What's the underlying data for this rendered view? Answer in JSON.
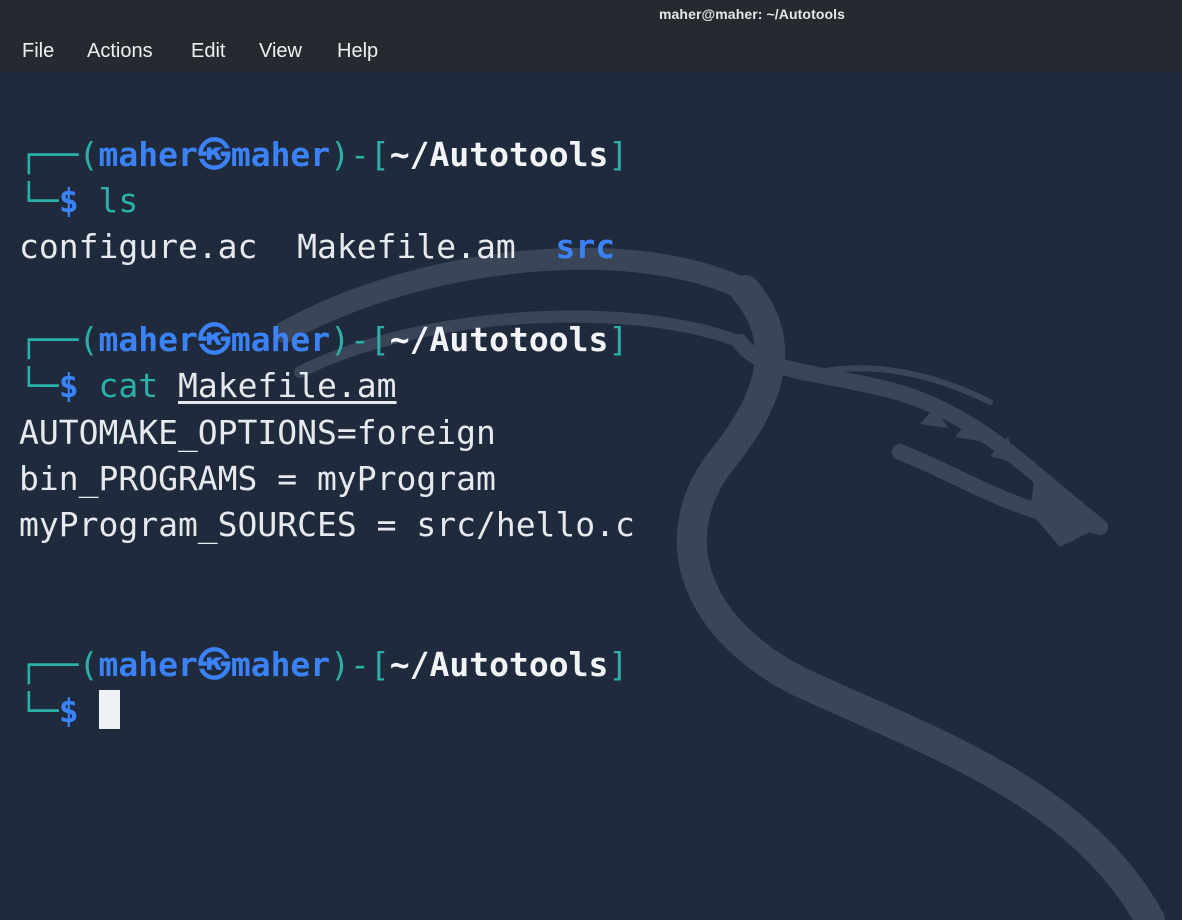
{
  "window": {
    "title": "maher@maher: ~/Autotools"
  },
  "menu": {
    "items": [
      "File",
      "Actions",
      "Edit",
      "View",
      "Help"
    ]
  },
  "prompt": {
    "user": "maher",
    "skull": "㉿",
    "host": "maher",
    "path": "~/Autotools",
    "dollar": "$"
  },
  "commands": {
    "first": "ls",
    "second_cmd": "cat",
    "second_arg": "Makefile.am"
  },
  "ls_output": {
    "file1": "configure.ac",
    "file2": "Makefile.am",
    "dir1": "src"
  },
  "cat_output": [
    "AUTOMAKE_OPTIONS=foreign",
    "bin_PROGRAMS = myProgram",
    "myProgram_SOURCES = src/hello.c"
  ],
  "icons": {
    "background": "kali-dragon-icon",
    "cursor": "text-cursor"
  },
  "colors": {
    "prompt_frame": "#2ab0a8",
    "prompt_user": "#3b82f6",
    "background": "#1f2b3c",
    "titlebar": "#252a31"
  }
}
